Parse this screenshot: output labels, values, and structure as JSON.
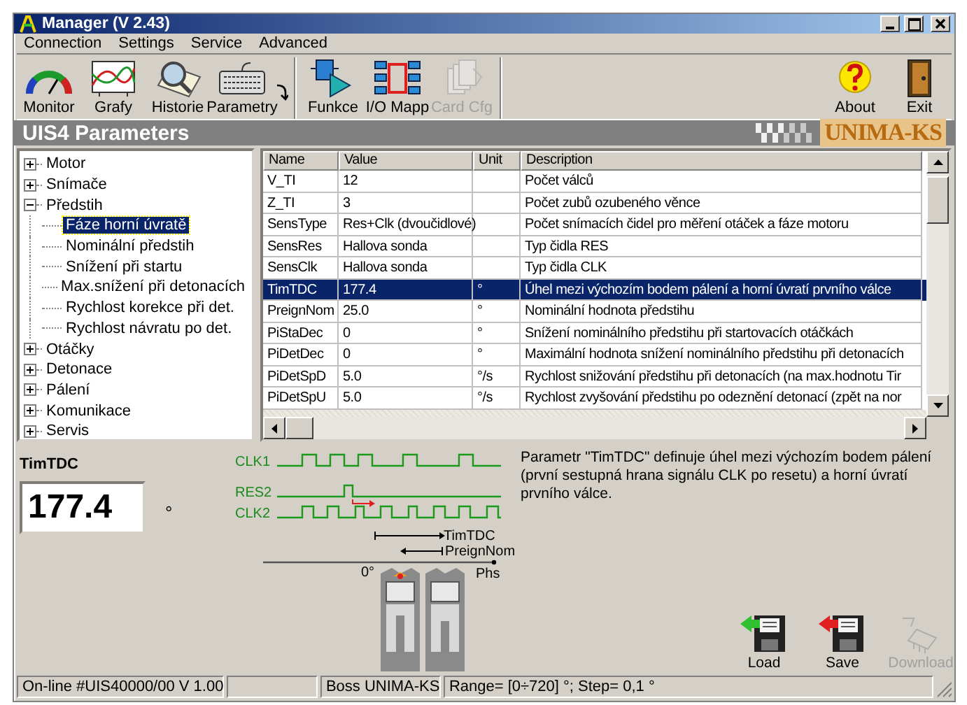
{
  "window": {
    "title": "Manager (V 2.43)"
  },
  "menu": [
    "Connection",
    "Settings",
    "Service",
    "Advanced"
  ],
  "toolbar": [
    {
      "label": "Monitor",
      "disabled": false
    },
    {
      "label": "Grafy",
      "disabled": false
    },
    {
      "label": "Historie",
      "disabled": false
    },
    {
      "label": "Parametry",
      "disabled": false
    },
    {
      "label": "Funkce",
      "disabled": false
    },
    {
      "label": "I/O Mapp",
      "disabled": false
    },
    {
      "label": "Card Cfg",
      "disabled": true
    }
  ],
  "toolbar_right": [
    {
      "label": "About",
      "disabled": false
    },
    {
      "label": "Exit",
      "disabled": false
    }
  ],
  "header": {
    "title": "UIS4 Parameters",
    "logo": "UNIMA-KS"
  },
  "tree": [
    {
      "label": "Motor",
      "expanded": false,
      "selected": false
    },
    {
      "label": "Snímače",
      "expanded": false,
      "selected": false
    },
    {
      "label": "Předstih",
      "expanded": true,
      "selected": false,
      "children": [
        {
          "label": "Fáze horní úvratě",
          "selected": true
        },
        {
          "label": "Nominální předstih",
          "selected": false
        },
        {
          "label": "Snížení při startu",
          "selected": false
        },
        {
          "label": "Max.snížení při detonacích",
          "selected": false
        },
        {
          "label": "Rychlost korekce při det.",
          "selected": false
        },
        {
          "label": "Rychlost návratu po det.",
          "selected": false
        }
      ]
    },
    {
      "label": "Otáčky",
      "expanded": false,
      "selected": false
    },
    {
      "label": "Detonace",
      "expanded": false,
      "selected": false
    },
    {
      "label": "Pálení",
      "expanded": false,
      "selected": false
    },
    {
      "label": "Komunikace",
      "expanded": false,
      "selected": false
    },
    {
      "label": "Servis",
      "expanded": false,
      "selected": false
    }
  ],
  "table": {
    "columns": [
      "Name",
      "Value",
      "Unit",
      "Description"
    ],
    "rows": [
      {
        "cells": [
          "V_TI",
          "12",
          "",
          "Počet válců"
        ],
        "selected": false
      },
      {
        "cells": [
          "Z_TI",
          "3",
          "",
          "Počet zubů ozubeného věnce"
        ],
        "selected": false
      },
      {
        "cells": [
          "SensType",
          "Res+Clk (dvoučidlové)",
          "",
          "Počet snímacích čidel pro měření otáček a fáze motoru"
        ],
        "selected": false
      },
      {
        "cells": [
          "SensRes",
          "Hallova sonda",
          "",
          "Typ čidla RES"
        ],
        "selected": false
      },
      {
        "cells": [
          "SensClk",
          "Hallova sonda",
          "",
          "Typ čidla CLK"
        ],
        "selected": false
      },
      {
        "cells": [
          "TimTDC",
          "177.4",
          "°",
          "Úhel mezi výchozím bodem pálení a horní úvratí prvního válce"
        ],
        "selected": true
      },
      {
        "cells": [
          "PreignNom",
          "25.0",
          "°",
          "Nominální hodnota předstihu"
        ],
        "selected": false
      },
      {
        "cells": [
          "PiStaDec",
          "0",
          "°",
          "Snížení nominálního předstihu při startovacích otáčkách"
        ],
        "selected": false
      },
      {
        "cells": [
          "PiDetDec",
          "0",
          "°",
          "Maximální hodnota snížení nominálního předstihu při detonacích"
        ],
        "selected": false
      },
      {
        "cells": [
          "PiDetSpD",
          "5.0",
          "°/s",
          "Rychlost snižování předstihu při detonacích (na max.hodnotu Tir"
        ],
        "selected": false
      },
      {
        "cells": [
          "PiDetSpU",
          "5.0",
          "°/s",
          "Rychlost zvyšování předstihu po odeznění detonací (zpět na nor"
        ],
        "selected": false
      }
    ]
  },
  "detail": {
    "name": "TimTDC",
    "value": "177.4",
    "unit": "°",
    "description": "Parametr \"TimTDC\" definuje úhel mezi výchozím bodem pálení (první sestupná hrana signálu CLK po resetu) a horní úvratí prvního válce."
  },
  "timing_diagram": {
    "signals": [
      "CLK1",
      "RES2",
      "CLK2"
    ],
    "markers": [
      "TimTDC",
      "PreignNom"
    ],
    "zero_label": "0°",
    "axis_label": "Phs"
  },
  "actions": [
    {
      "label": "Load",
      "disabled": false
    },
    {
      "label": "Save",
      "disabled": false
    },
    {
      "label": "Download",
      "disabled": true
    }
  ],
  "status_bar": [
    "On-line #UIS40000/00  V 1.00",
    "Boss UNIMA-KS",
    "Range= [0÷720] °; Step= 0,1 °"
  ]
}
